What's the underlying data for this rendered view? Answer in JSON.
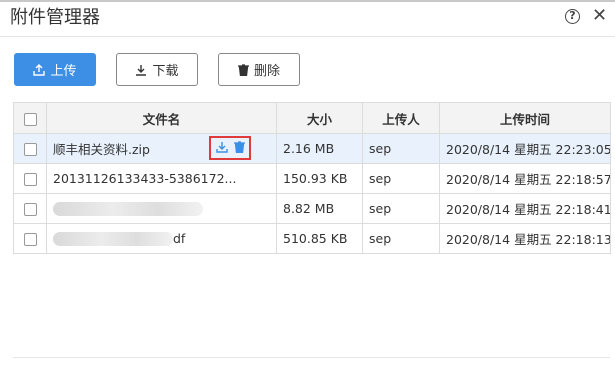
{
  "dialog": {
    "title": "附件管理器"
  },
  "toolbar": {
    "upload_label": "上传",
    "download_label": "下载",
    "delete_label": "删除"
  },
  "table": {
    "headers": {
      "name": "文件名",
      "size": "大小",
      "uploader": "上传人",
      "time": "上传时间"
    },
    "rows": [
      {
        "name": "顺丰相关资料.zip",
        "size": "2.16 MB",
        "uploader": "sep",
        "time": "2020/8/14 星期五 22:23:05"
      },
      {
        "name": "20131126133433-5386172...",
        "size": "150.93 KB",
        "uploader": "sep",
        "time": "2020/8/14 星期五 22:18:57"
      },
      {
        "name": "",
        "size": "8.82 MB",
        "uploader": "sep",
        "time": "2020/8/14 星期五 22:18:41"
      },
      {
        "name": "df",
        "size": "510.85 KB",
        "uploader": "sep",
        "time": "2020/8/14 星期五 22:18:13"
      }
    ]
  },
  "colors": {
    "primary": "#3d8fe6",
    "highlight_border": "#e03a3a",
    "row_selected": "#e8f1fc"
  },
  "icons": [
    "help-icon",
    "close-icon",
    "upload-icon",
    "download-icon",
    "trash-icon"
  ]
}
